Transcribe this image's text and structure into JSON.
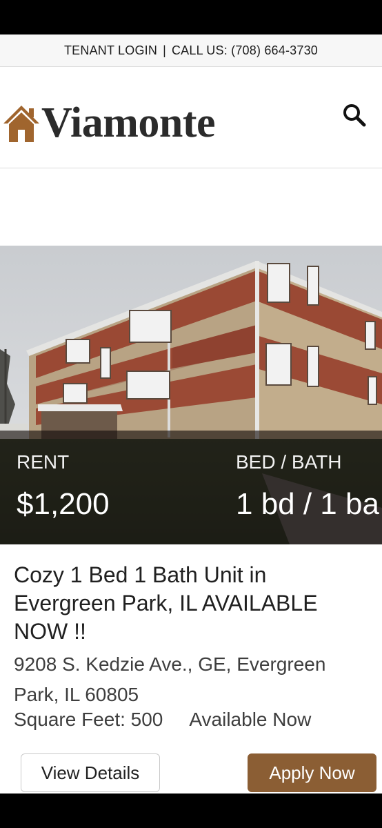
{
  "utility_bar": {
    "tenant_login": "TENANT LOGIN",
    "separator": "|",
    "call_us": "CALL US: (708) 664-3730"
  },
  "header": {
    "brand": "Viamonte",
    "logo_icon": "house-icon",
    "search_icon": "search-icon"
  },
  "listing": {
    "rent_label": "RENT",
    "rent_value": "$1,200",
    "bedbath_label": "BED / BATH",
    "bedbath_value": "1 bd / 1 ba",
    "title": "Cozy 1 Bed 1 Bath Unit in Evergreen Park, IL AVAILABLE NOW !!",
    "address": "9208 S. Kedzie Ave., GE, Evergreen Park, IL 60805",
    "square_feet": "Square Feet: 500",
    "availability": "Available Now",
    "view_details_label": "View Details",
    "apply_now_label": "Apply Now"
  },
  "colors": {
    "brand_accent": "#8b5e34",
    "logo_house": "#a0652e",
    "text_dark": "#202020"
  }
}
